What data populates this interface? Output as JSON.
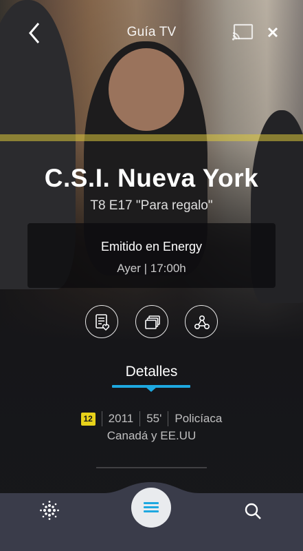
{
  "header": {
    "title": "Guía TV"
  },
  "show": {
    "title": "C.S.I. Nueva York",
    "episode": "T8 E17 \"Para regalo\""
  },
  "broadcast": {
    "channel_line": "Emitido en Energy",
    "time_line": "Ayer | 17:00h"
  },
  "actions": {
    "icons": [
      "watchlist-heart-icon",
      "episodes-stack-icon",
      "share-icon"
    ]
  },
  "tabs": {
    "active": "Detalles"
  },
  "details": {
    "age_rating": "12",
    "year": "2011",
    "duration": "55'",
    "genre": "Policíaca",
    "country": "Canadá y EE.UU"
  },
  "nav": {
    "icons": [
      "home-dots-icon",
      "menu-icon",
      "search-icon"
    ]
  },
  "colors": {
    "accent": "#1ea8e0",
    "rating_badge": "#e8d21a",
    "nav_background": "#3a3c4a"
  }
}
